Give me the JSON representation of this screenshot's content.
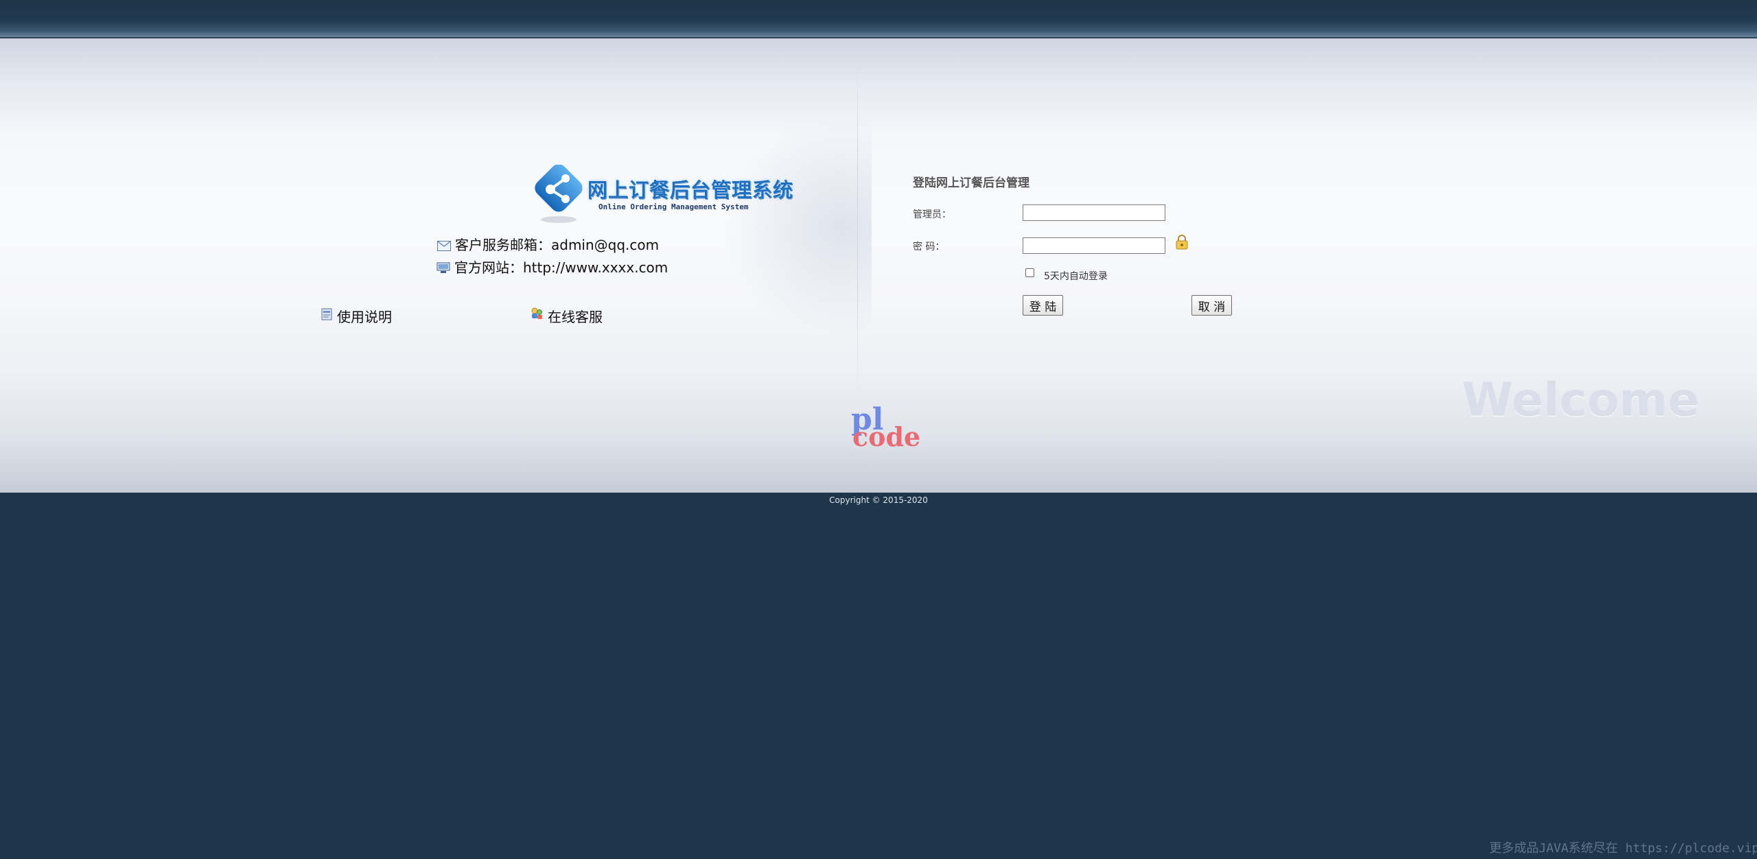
{
  "logo": {
    "title": "网上订餐后台管理系统",
    "subtitle": "Online Ordering Management System"
  },
  "contact": {
    "email_label": "客户服务邮箱：admin@qq.com",
    "site_label": "官方网站：http://www.xxxx.com"
  },
  "links": {
    "help": "使用说明",
    "service": "在线客服"
  },
  "form": {
    "title": "登陆网上订餐后台管理",
    "admin_label": "管理员：",
    "admin_value": "",
    "password_label": "密 码：",
    "password_value": "",
    "remember_label": "5天内自动登录",
    "remember_checked": false,
    "login_button": "登 陆",
    "cancel_button": "取 消"
  },
  "decor": {
    "welcome": "Welcome",
    "watermark_top": "pl",
    "watermark_bottom": "code"
  },
  "footer": {
    "copyright": "Copyright © 2015-2020",
    "note": "更多成品JAVA系统尽在 https://plcode.vip"
  },
  "colors": {
    "header_bg": "#213a51",
    "page_bg": "#1f354a",
    "logo_blue": "#1f6fc0"
  }
}
